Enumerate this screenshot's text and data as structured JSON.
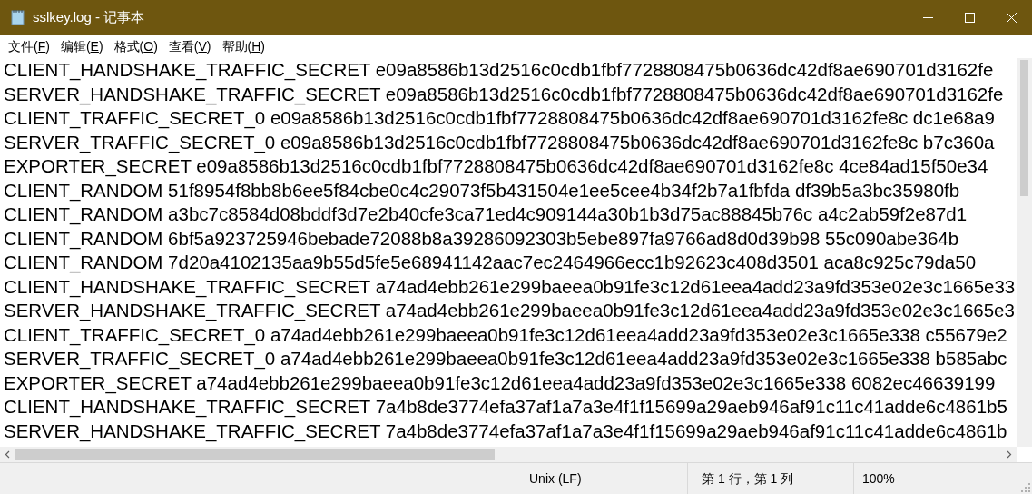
{
  "window": {
    "title": "sslkey.log - 记事本"
  },
  "menu": [
    "文件(F)",
    "编辑(E)",
    "格式(O)",
    "查看(V)",
    "帮助(H)"
  ],
  "lines": [
    "CLIENT_HANDSHAKE_TRAFFIC_SECRET e09a8586b13d2516c0cdb1fbf7728808475b0636dc42df8ae690701d3162fe",
    "SERVER_HANDSHAKE_TRAFFIC_SECRET e09a8586b13d2516c0cdb1fbf7728808475b0636dc42df8ae690701d3162fe",
    "CLIENT_TRAFFIC_SECRET_0 e09a8586b13d2516c0cdb1fbf7728808475b0636dc42df8ae690701d3162fe8c dc1e68a9",
    "SERVER_TRAFFIC_SECRET_0 e09a8586b13d2516c0cdb1fbf7728808475b0636dc42df8ae690701d3162fe8c b7c360a",
    "EXPORTER_SECRET e09a8586b13d2516c0cdb1fbf7728808475b0636dc42df8ae690701d3162fe8c 4ce84ad15f50e34",
    "CLIENT_RANDOM 51f8954f8bb8b6ee5f84cbe0c4c29073f5b431504e1ee5cee4b34f2b7a1fbfda df39b5a3bc35980fb",
    "CLIENT_RANDOM a3bc7c8584d08bddf3d7e2b40cfe3ca71ed4c909144a30b1b3d75ac88845b76c a4c2ab59f2e87d1",
    "CLIENT_RANDOM 6bf5a923725946bebade72088b8a39286092303b5ebe897fa9766ad8d0d39b98 55c090abe364b",
    "CLIENT_RANDOM 7d20a4102135aa9b55d5fe5e68941142aac7ec2464966ecc1b92623c408d3501 aca8c925c79da50",
    "CLIENT_HANDSHAKE_TRAFFIC_SECRET a74ad4ebb261e299baeea0b91fe3c12d61eea4add23a9fd353e02e3c1665e33",
    "SERVER_HANDSHAKE_TRAFFIC_SECRET a74ad4ebb261e299baeea0b91fe3c12d61eea4add23a9fd353e02e3c1665e3",
    "CLIENT_TRAFFIC_SECRET_0 a74ad4ebb261e299baeea0b91fe3c12d61eea4add23a9fd353e02e3c1665e338 c55679e2",
    "SERVER_TRAFFIC_SECRET_0 a74ad4ebb261e299baeea0b91fe3c12d61eea4add23a9fd353e02e3c1665e338 b585abc",
    "EXPORTER_SECRET a74ad4ebb261e299baeea0b91fe3c12d61eea4add23a9fd353e02e3c1665e338 6082ec46639199",
    "CLIENT_HANDSHAKE_TRAFFIC_SECRET 7a4b8de3774efa37af1a7a3e4f1f15699a29aeb946af91c11c41adde6c4861b5",
    "SERVER_HANDSHAKE_TRAFFIC_SECRET 7a4b8de3774efa37af1a7a3e4f1f15699a29aeb946af91c11c41adde6c4861b"
  ],
  "status_bar": {
    "line_ending": "Unix (LF)",
    "position": "第 1 行，第 1 列",
    "zoom": "100%"
  }
}
